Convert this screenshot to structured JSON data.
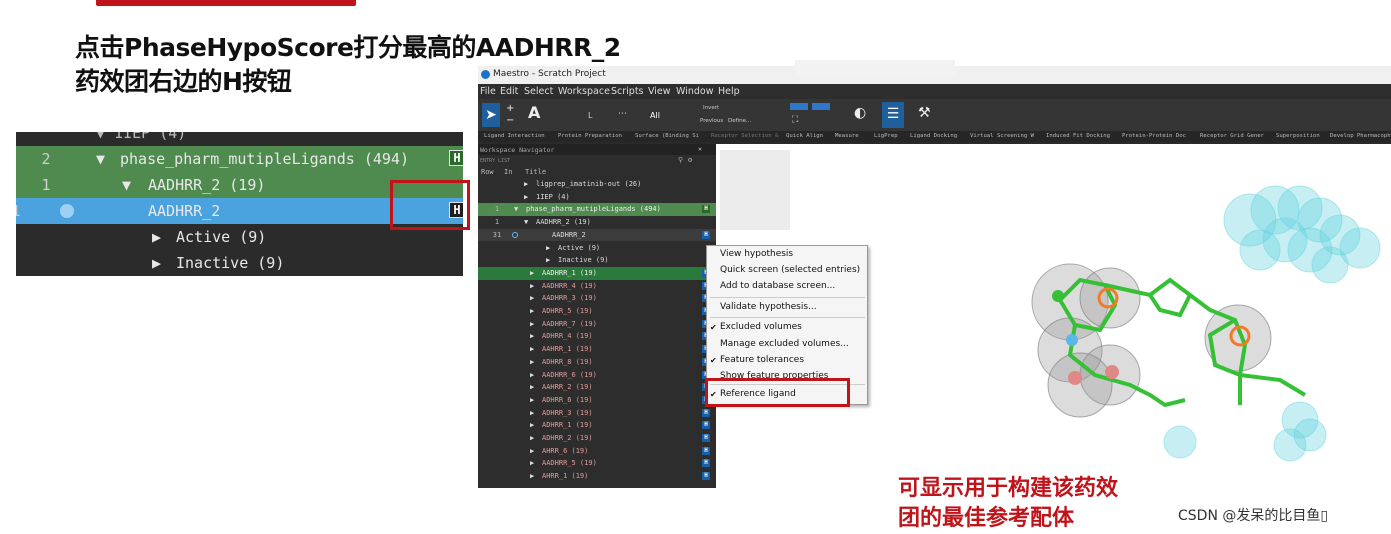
{
  "headline": {
    "line1": "点击PhaseHypoScore打分最高的AADHRR_2",
    "line2": "药效团右边的H按钮"
  },
  "zoom_panel": {
    "rows": [
      {
        "num": "",
        "text": "▼ 1IEP (4)"
      },
      {
        "num": "2",
        "text": "phase_pharm_mutipleLigands (494)",
        "h": "H"
      },
      {
        "num": "1",
        "text": "AADHRR_2 (19)"
      },
      {
        "num": "1",
        "text": "AADHRR_2",
        "h": "H"
      },
      {
        "num": "",
        "text": "Active (9)"
      },
      {
        "num": "",
        "text": "Inactive (9)"
      }
    ]
  },
  "window": {
    "title": "Maestro - Scratch Project",
    "menu": [
      "File",
      "Edit",
      "Select",
      "Workspace",
      "Scripts",
      "View",
      "Window",
      "Help"
    ],
    "toolbar": {
      "all": "All",
      "previous": "Previous",
      "define": "Define...",
      "invert": "Invert"
    },
    "task_tabs": [
      "Ligand Interaction",
      "Protein Preparation",
      "Surface (Binding Si",
      "Receptor Selection &",
      "Quick Align",
      "Measure",
      "LigPrep",
      "Ligand Docking",
      "Virtual Screening W",
      "Induced Fit Docking",
      "Protein-Protein Doc",
      "Receptor Grid Gener",
      "Superposition",
      "Develop Pharmacoph"
    ],
    "navigator": {
      "title": "Workspace Navigator",
      "subtitle": "ENTRY LIST",
      "col_row": "Row",
      "col_in": "In",
      "col_title": "Title",
      "rows": [
        {
          "row": "",
          "text": "ligprep_imatinib-out (26)"
        },
        {
          "row": "",
          "text": "1IEP (4)"
        },
        {
          "row": "1",
          "text": "phase_pharm_mutipleLigands (494)"
        },
        {
          "row": "1",
          "text": "AADHRR_2 (19)"
        },
        {
          "row": "31",
          "text": "AADHRR_2"
        },
        {
          "row": "",
          "text": "Active (9)"
        },
        {
          "row": "",
          "text": "Inactive (9)"
        },
        {
          "row": "",
          "text": "AADHRR_1 (19)"
        },
        {
          "row": "",
          "text": "AADHRR_4 (19)"
        },
        {
          "row": "",
          "text": "AADHRR_3 (19)"
        },
        {
          "row": "",
          "text": "ADHRR_5 (19)"
        },
        {
          "row": "",
          "text": "AADHRR_7 (19)"
        },
        {
          "row": "",
          "text": "ADHRR_4 (19)"
        },
        {
          "row": "",
          "text": "AAHRR_1 (19)"
        },
        {
          "row": "",
          "text": "ADHRR_8 (19)"
        },
        {
          "row": "",
          "text": "AADHRR_6 (19)"
        },
        {
          "row": "",
          "text": "AAHRR_2 (19)"
        },
        {
          "row": "",
          "text": "ADHRR_6 (19)"
        },
        {
          "row": "",
          "text": "ADHRR_3 (19)"
        },
        {
          "row": "",
          "text": "ADHRR_1 (19)"
        },
        {
          "row": "",
          "text": "ADHRR_2 (19)"
        },
        {
          "row": "",
          "text": "AHRR_6 (19)"
        },
        {
          "row": "",
          "text": "AADHRR_5 (19)"
        },
        {
          "row": "",
          "text": "AHRR_1 (19)"
        }
      ]
    },
    "context_menu": {
      "items": [
        {
          "label": "View hypothesis",
          "check": ""
        },
        {
          "label": "Quick screen (selected entries)",
          "check": ""
        },
        {
          "label": "Add to database screen...",
          "check": ""
        },
        {
          "label": "Validate hypothesis...",
          "check": ""
        },
        {
          "label": "Excluded volumes",
          "check": "✔"
        },
        {
          "label": "Manage excluded volumes...",
          "check": ""
        },
        {
          "label": "Feature tolerances",
          "check": "✔"
        },
        {
          "label": "Show feature properties",
          "check": ""
        },
        {
          "label": "Reference ligand",
          "check": "✔"
        }
      ]
    }
  },
  "annotation": {
    "line1": "可显示用于构建该药效",
    "line2": "团的最佳参考配体"
  },
  "watermark": "CSDN @发呆的比目鱼▯",
  "colors": {
    "accent_red": "#c0141b",
    "selected_blue": "#4aa3df",
    "group_green": "#4f8a4f"
  }
}
